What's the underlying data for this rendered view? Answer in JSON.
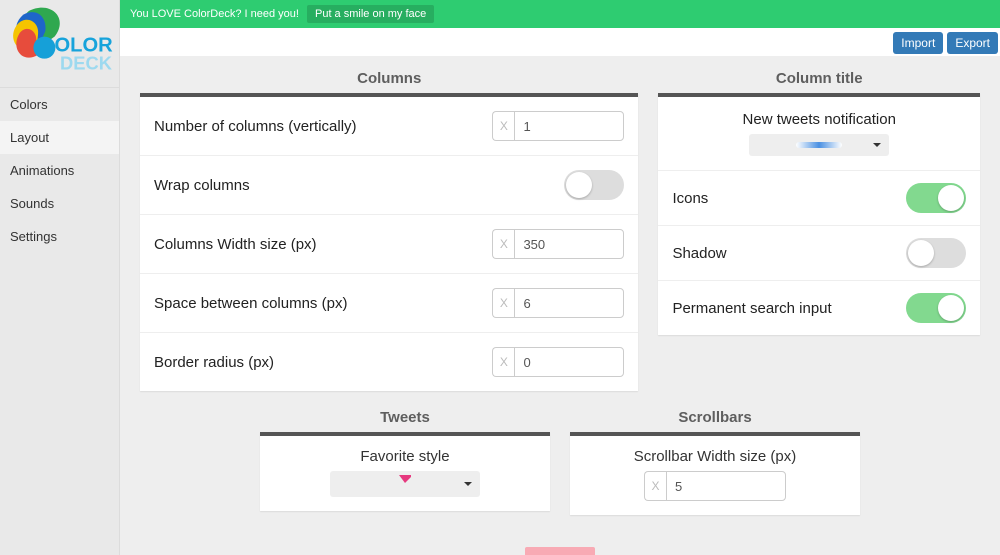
{
  "banner": {
    "msg": "You LOVE ColorDeck? I need you!",
    "cta": "Put a smile on my face"
  },
  "topbar": {
    "import": "Import",
    "export": "Export"
  },
  "logo": {
    "word1": "OLOR",
    "word2": "DECK"
  },
  "nav": {
    "items": [
      {
        "label": "Colors",
        "active": false
      },
      {
        "label": "Layout",
        "active": true
      },
      {
        "label": "Animations",
        "active": false
      },
      {
        "label": "Sounds",
        "active": false
      },
      {
        "label": "Settings",
        "active": false
      }
    ]
  },
  "columns": {
    "title": "Columns",
    "reset_glyph": "X",
    "number": {
      "label": "Number of columns (vertically)",
      "value": "1"
    },
    "wrap": {
      "label": "Wrap columns",
      "value": false
    },
    "width": {
      "label": "Columns Width size (px)",
      "value": "350"
    },
    "space": {
      "label": "Space between columns (px)",
      "value": "6"
    },
    "radius": {
      "label": "Border radius (px)",
      "value": "0"
    }
  },
  "column_title": {
    "title": "Column title",
    "notif_label": "New tweets notification",
    "icons": {
      "label": "Icons",
      "value": true
    },
    "shadow": {
      "label": "Shadow",
      "value": false
    },
    "search": {
      "label": "Permanent search input",
      "value": true
    }
  },
  "tweets": {
    "title": "Tweets",
    "fav_label": "Favorite style"
  },
  "scrollbars": {
    "title": "Scrollbars",
    "width": {
      "label": "Scrollbar Width size (px)",
      "value": "5"
    }
  }
}
